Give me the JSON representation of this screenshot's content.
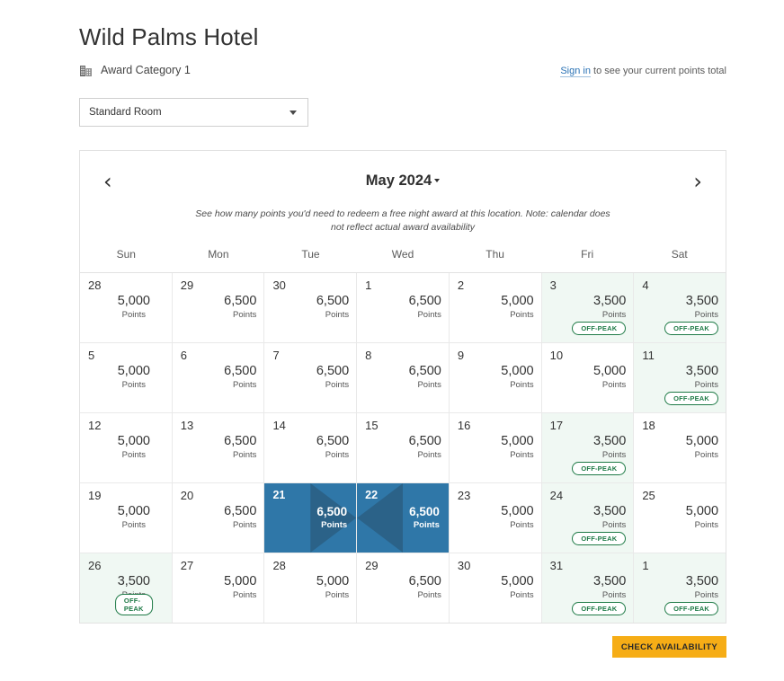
{
  "header": {
    "hotel_name": "Wild Palms Hotel",
    "award_category": "Award Category 1",
    "award_icon": "building-icon",
    "signin_link_text": "Sign in",
    "signin_rest_text": " to see your current points total"
  },
  "room_select": {
    "name": "room-type-select",
    "value": "Standard Room",
    "caret_icon": "chevron-down-icon"
  },
  "calendar": {
    "prev_icon": "chevron-left-icon",
    "next_icon": "chevron-right-icon",
    "month_label": "May 2024",
    "month_caret_icon": "chevron-down-icon",
    "note_line1": "See how many points you'd need to redeem a free night award at this",
    "note_line2": "location. Note: calendar does not reflect actual award availability",
    "day_headers": [
      "Sun",
      "Mon",
      "Tue",
      "Wed",
      "Thu",
      "Fri",
      "Sat"
    ],
    "points_unit": "Points",
    "offpeak_badge": "OFF-PEAK",
    "weeks": [
      [
        {
          "day": "28",
          "points": "5,000",
          "offpeak": false,
          "selected": false
        },
        {
          "day": "29",
          "points": "6,500",
          "offpeak": false,
          "selected": false
        },
        {
          "day": "30",
          "points": "6,500",
          "offpeak": false,
          "selected": false
        },
        {
          "day": "1",
          "points": "6,500",
          "offpeak": false,
          "selected": false
        },
        {
          "day": "2",
          "points": "5,000",
          "offpeak": false,
          "selected": false
        },
        {
          "day": "3",
          "points": "3,500",
          "offpeak": true,
          "selected": false
        },
        {
          "day": "4",
          "points": "3,500",
          "offpeak": true,
          "selected": false
        }
      ],
      [
        {
          "day": "5",
          "points": "5,000",
          "offpeak": false,
          "selected": false
        },
        {
          "day": "6",
          "points": "6,500",
          "offpeak": false,
          "selected": false
        },
        {
          "day": "7",
          "points": "6,500",
          "offpeak": false,
          "selected": false
        },
        {
          "day": "8",
          "points": "6,500",
          "offpeak": false,
          "selected": false
        },
        {
          "day": "9",
          "points": "5,000",
          "offpeak": false,
          "selected": false
        },
        {
          "day": "10",
          "points": "5,000",
          "offpeak": false,
          "selected": false
        },
        {
          "day": "11",
          "points": "3,500",
          "offpeak": true,
          "selected": false
        }
      ],
      [
        {
          "day": "12",
          "points": "5,000",
          "offpeak": false,
          "selected": false
        },
        {
          "day": "13",
          "points": "6,500",
          "offpeak": false,
          "selected": false
        },
        {
          "day": "14",
          "points": "6,500",
          "offpeak": false,
          "selected": false
        },
        {
          "day": "15",
          "points": "6,500",
          "offpeak": false,
          "selected": false
        },
        {
          "day": "16",
          "points": "5,000",
          "offpeak": false,
          "selected": false
        },
        {
          "day": "17",
          "points": "3,500",
          "offpeak": true,
          "selected": false
        },
        {
          "day": "18",
          "points": "5,000",
          "offpeak": false,
          "selected": false
        }
      ],
      [
        {
          "day": "19",
          "points": "5,000",
          "offpeak": false,
          "selected": false
        },
        {
          "day": "20",
          "points": "6,500",
          "offpeak": false,
          "selected": false
        },
        {
          "day": "21",
          "points": "6,500",
          "offpeak": false,
          "selected": "start"
        },
        {
          "day": "22",
          "points": "6,500",
          "offpeak": false,
          "selected": "end"
        },
        {
          "day": "23",
          "points": "5,000",
          "offpeak": false,
          "selected": false
        },
        {
          "day": "24",
          "points": "3,500",
          "offpeak": true,
          "selected": false
        },
        {
          "day": "25",
          "points": "5,000",
          "offpeak": false,
          "selected": false
        }
      ],
      [
        {
          "day": "26",
          "points": "3,500",
          "offpeak": true,
          "selected": false
        },
        {
          "day": "27",
          "points": "5,000",
          "offpeak": false,
          "selected": false
        },
        {
          "day": "28",
          "points": "5,000",
          "offpeak": false,
          "selected": false
        },
        {
          "day": "29",
          "points": "6,500",
          "offpeak": false,
          "selected": false
        },
        {
          "day": "30",
          "points": "5,000",
          "offpeak": false,
          "selected": false
        },
        {
          "day": "31",
          "points": "3,500",
          "offpeak": true,
          "selected": false
        },
        {
          "day": "1",
          "points": "3,500",
          "offpeak": true,
          "selected": false
        }
      ]
    ]
  },
  "cta": {
    "label": "CHECK AVAILABILITY"
  },
  "colors": {
    "selected_bg": "#2f77a8",
    "selected_wedge": "#2b6288",
    "offpeak_bg": "#f0f8f3",
    "offpeak_border": "#1e7a46",
    "cta_bg": "#f6ad16",
    "link": "#2a72b5"
  }
}
